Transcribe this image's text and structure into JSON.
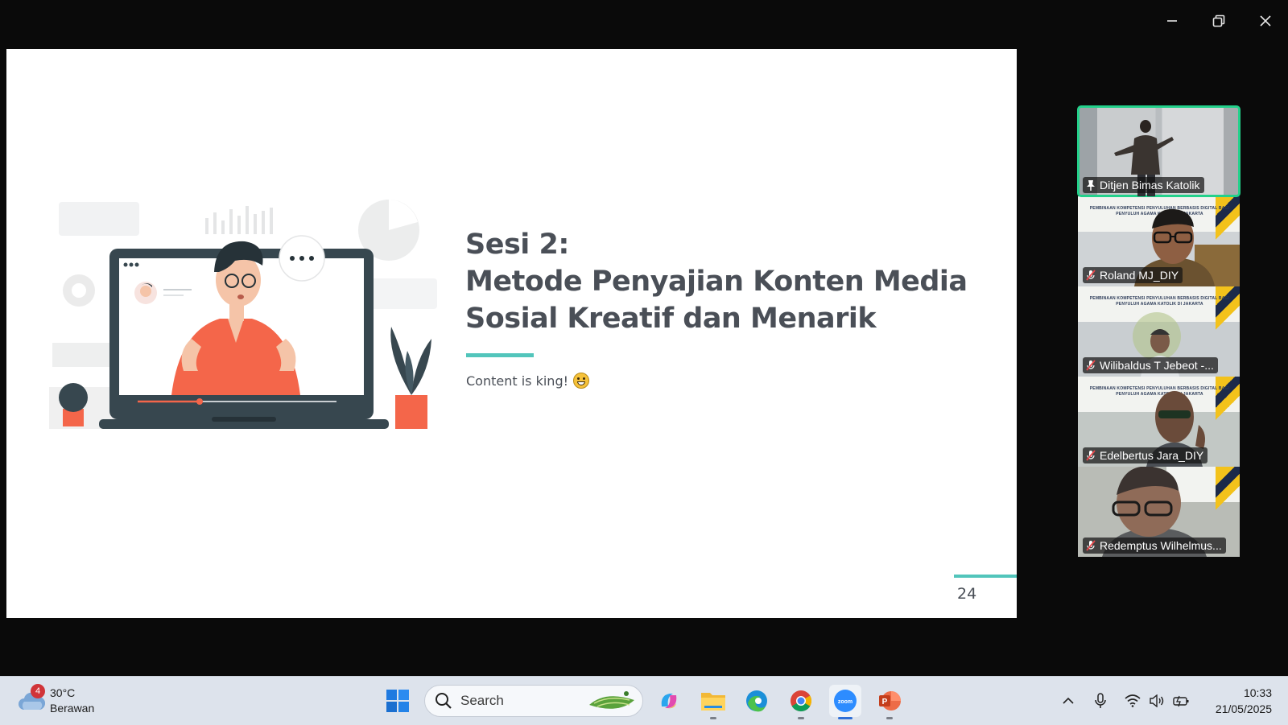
{
  "window": {
    "controls": [
      "minimize",
      "restore",
      "close"
    ]
  },
  "slide": {
    "title_lines": [
      "Sesi 2:",
      "Metode Penyajian Konten Media",
      "Sosial Kreatif dan Menarik"
    ],
    "subtitle": "Content is king!",
    "page_number": "24",
    "accent_color": "#52c5bb",
    "text_color": "#4a4f57"
  },
  "banner_text": "PEMBINAAN KOMPETENSI PENYULUHAN BERBASIS DIGITAL BAGI PENYULUH AGAMA KATOLIK DI JAKARTA",
  "participants": [
    {
      "name": "Ditjen Bimas Katolik",
      "status_icon": "pin-icon",
      "active": true
    },
    {
      "name": "Roland MJ_DIY",
      "status_icon": "mic-muted-icon",
      "active": false
    },
    {
      "name": "Wilibaldus T Jebeot -...",
      "status_icon": "mic-muted-icon",
      "active": false
    },
    {
      "name": "Edelbertus Jara_DIY",
      "status_icon": "mic-muted-icon",
      "active": false
    },
    {
      "name": "Redemptus Wilhelmus...",
      "status_icon": "mic-muted-icon",
      "active": false
    }
  ],
  "taskbar": {
    "weather": {
      "badge": "4",
      "temp": "30°C",
      "condition": "Berawan"
    },
    "search_placeholder": "Search",
    "apps": [
      "start",
      "copilot",
      "file-explorer",
      "edge",
      "chrome",
      "zoom",
      "powerpoint"
    ],
    "active_app": "zoom",
    "time": "10:33",
    "date": "21/05/2025"
  }
}
